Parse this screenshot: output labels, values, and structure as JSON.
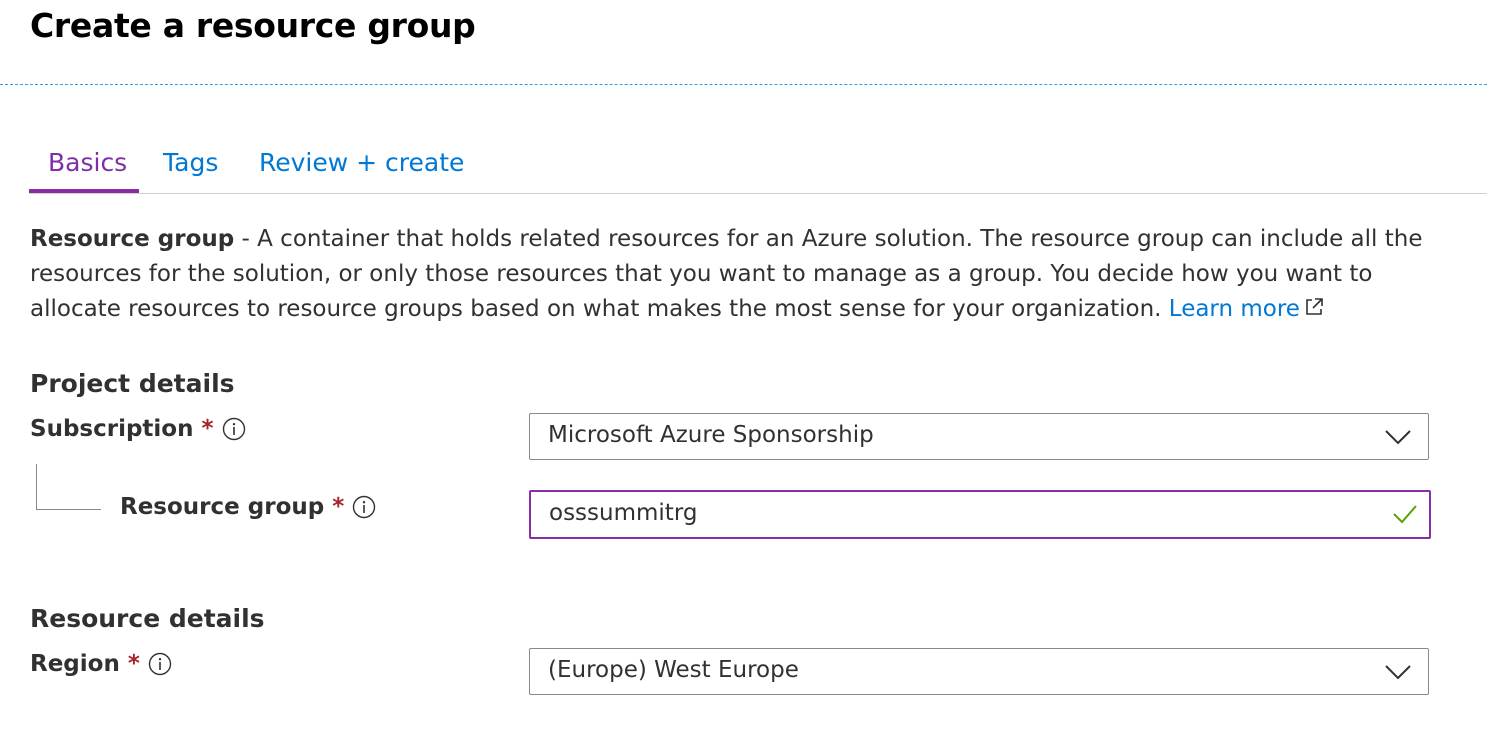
{
  "page": {
    "title": "Create a resource group"
  },
  "tabs": [
    {
      "label": "Basics",
      "active": true
    },
    {
      "label": "Tags",
      "active": false
    },
    {
      "label": "Review + create",
      "active": false
    }
  ],
  "description": {
    "term": "Resource group",
    "text": " - A container that holds related resources for an Azure solution. The resource group can include all the resources for the solution, or only those resources that you want to manage as a group. You decide how you want to allocate resources to resource groups based on what makes the most sense for your organization. ",
    "link_label": "Learn more"
  },
  "project_details": {
    "heading": "Project details",
    "subscription": {
      "label": "Subscription",
      "required_mark": "*",
      "value": "Microsoft Azure Sponsorship"
    },
    "resource_group": {
      "label": "Resource group",
      "required_mark": "*",
      "value": "osssummitrg",
      "valid": true
    }
  },
  "resource_details": {
    "heading": "Resource details",
    "region": {
      "label": "Region",
      "required_mark": "*",
      "value": "(Europe) West Europe"
    }
  },
  "colors": {
    "accent_purple": "#8a2da5",
    "link_blue": "#0078d4",
    "required_red": "#a4262c",
    "valid_green": "#57a300",
    "divider_blue": "#2aa0e8"
  },
  "icons": {
    "external_link": "external-link-icon",
    "info": "info-icon",
    "dropdown": "chevron-down-icon",
    "valid": "checkmark-icon"
  }
}
